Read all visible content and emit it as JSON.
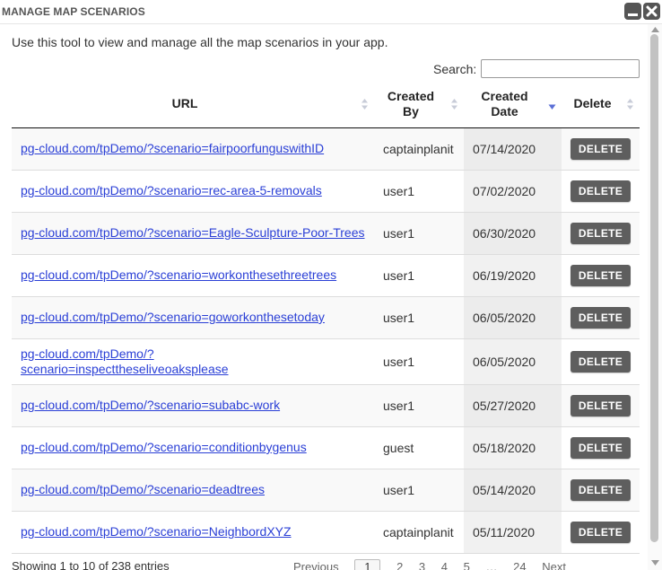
{
  "window": {
    "title": "MANAGE MAP SCENARIOS"
  },
  "intro_text": "Use this tool to view and manage all the map scenarios in your app.",
  "search": {
    "label": "Search:",
    "value": ""
  },
  "table": {
    "headers": {
      "url": "URL",
      "created_by_line1": "Created",
      "created_by_line2": "By",
      "created_date_line1": "Created",
      "created_date_line2": "Date",
      "delete": "Delete"
    },
    "sort": {
      "column": "Created Date",
      "direction": "descending",
      "active_color": "#5b6fd6"
    },
    "delete_label": "DELETE",
    "rows": [
      {
        "url": "pg-cloud.com/tpDemo/?scenario=fairpoorfunguswithID",
        "created_by": "captainplanit",
        "created_date": "07/14/2020"
      },
      {
        "url": "pg-cloud.com/tpDemo/?scenario=rec-area-5-removals",
        "created_by": "user1",
        "created_date": "07/02/2020"
      },
      {
        "url": "pg-cloud.com/tpDemo/?scenario=Eagle-Sculpture-Poor-Trees",
        "created_by": "user1",
        "created_date": "06/30/2020"
      },
      {
        "url": "pg-cloud.com/tpDemo/?scenario=workonthesethreetrees",
        "created_by": "user1",
        "created_date": "06/19/2020"
      },
      {
        "url": "pg-cloud.com/tpDemo/?scenario=goworkonthesetoday",
        "created_by": "user1",
        "created_date": "06/05/2020"
      },
      {
        "url_line1": "pg-cloud.com/tpDemo/?",
        "url_line2": "scenario=inspecttheseliveoaksplease",
        "created_by": "user1",
        "created_date": "06/05/2020"
      },
      {
        "url": "pg-cloud.com/tpDemo/?scenario=subabc-work",
        "created_by": "user1",
        "created_date": "05/27/2020"
      },
      {
        "url": "pg-cloud.com/tpDemo/?scenario=conditionbygenus",
        "created_by": "guest",
        "created_date": "05/18/2020"
      },
      {
        "url": "pg-cloud.com/tpDemo/?scenario=deadtrees",
        "created_by": "user1",
        "created_date": "05/14/2020"
      },
      {
        "url": "pg-cloud.com/tpDemo/?scenario=NeighbordXYZ",
        "created_by": "captainplanit",
        "created_date": "05/11/2020"
      }
    ]
  },
  "footer": {
    "info": "Showing 1 to 10 of 238 entries",
    "pager": [
      "Previous",
      "1",
      "2",
      "3",
      "4",
      "5",
      "…",
      "24",
      "Next"
    ],
    "current_page": "1"
  },
  "colors": {
    "link": "#2a3fd6",
    "delete_button": "#5e5e5e",
    "title_text": "#555555"
  }
}
